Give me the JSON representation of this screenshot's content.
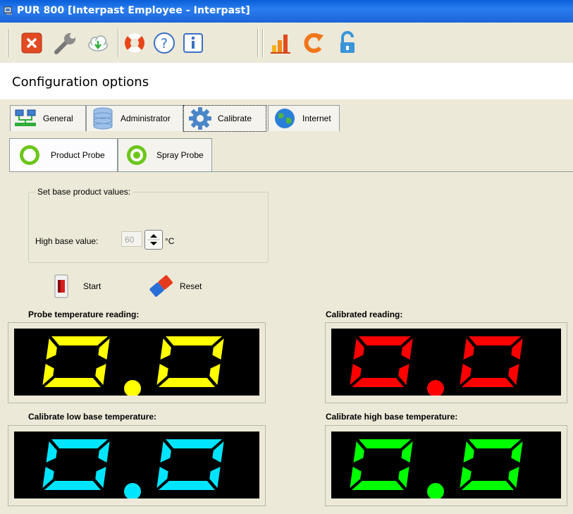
{
  "window": {
    "title": "PUR 800 [Interpast Employee - Interpast]"
  },
  "toolbar": {
    "buttons": [
      {
        "name": "close-button",
        "icon": "close-icon"
      },
      {
        "name": "settings-button",
        "icon": "wrench-icon"
      },
      {
        "name": "download-button",
        "icon": "cloud-download-icon"
      },
      {
        "name": "support-button",
        "icon": "lifebuoy-icon"
      },
      {
        "name": "help-button",
        "icon": "help-icon"
      },
      {
        "name": "info-button",
        "icon": "info-icon"
      },
      {
        "name": "chart-button",
        "icon": "bar-chart-icon"
      },
      {
        "name": "refresh-button",
        "icon": "refresh-icon"
      },
      {
        "name": "unlock-button",
        "icon": "unlock-icon"
      }
    ]
  },
  "page": {
    "heading": "Configuration options"
  },
  "tabs": [
    {
      "label": "General",
      "icon": "network-icon"
    },
    {
      "label": "Administrator",
      "icon": "database-icon"
    },
    {
      "label": "Calibrate",
      "icon": "gear-icon",
      "selected": true
    },
    {
      "label": "Internet",
      "icon": "globe-icon"
    }
  ],
  "subtabs": [
    {
      "label": "Product Probe",
      "icon": "ring-icon",
      "selected": true
    },
    {
      "label": "Spray Probe",
      "icon": "dot-ring-icon"
    }
  ],
  "base_values": {
    "group_label": "Set base product values:",
    "high_label": "High base value:",
    "high_value": "60",
    "unit": "°C"
  },
  "actions": {
    "start": "Start",
    "reset": "Reset"
  },
  "displays": [
    {
      "heading": "Probe temperature reading:",
      "value": "0.0",
      "color": "#ffff00"
    },
    {
      "heading": "Calibrated reading:",
      "value": "0.0",
      "color": "#ff0000"
    },
    {
      "heading": "Calibrate low base temperature:",
      "value": "0.0",
      "color": "#00e5ff"
    },
    {
      "heading": "Calibrate high base temperature:",
      "value": "0.0",
      "color": "#00ff00"
    }
  ]
}
